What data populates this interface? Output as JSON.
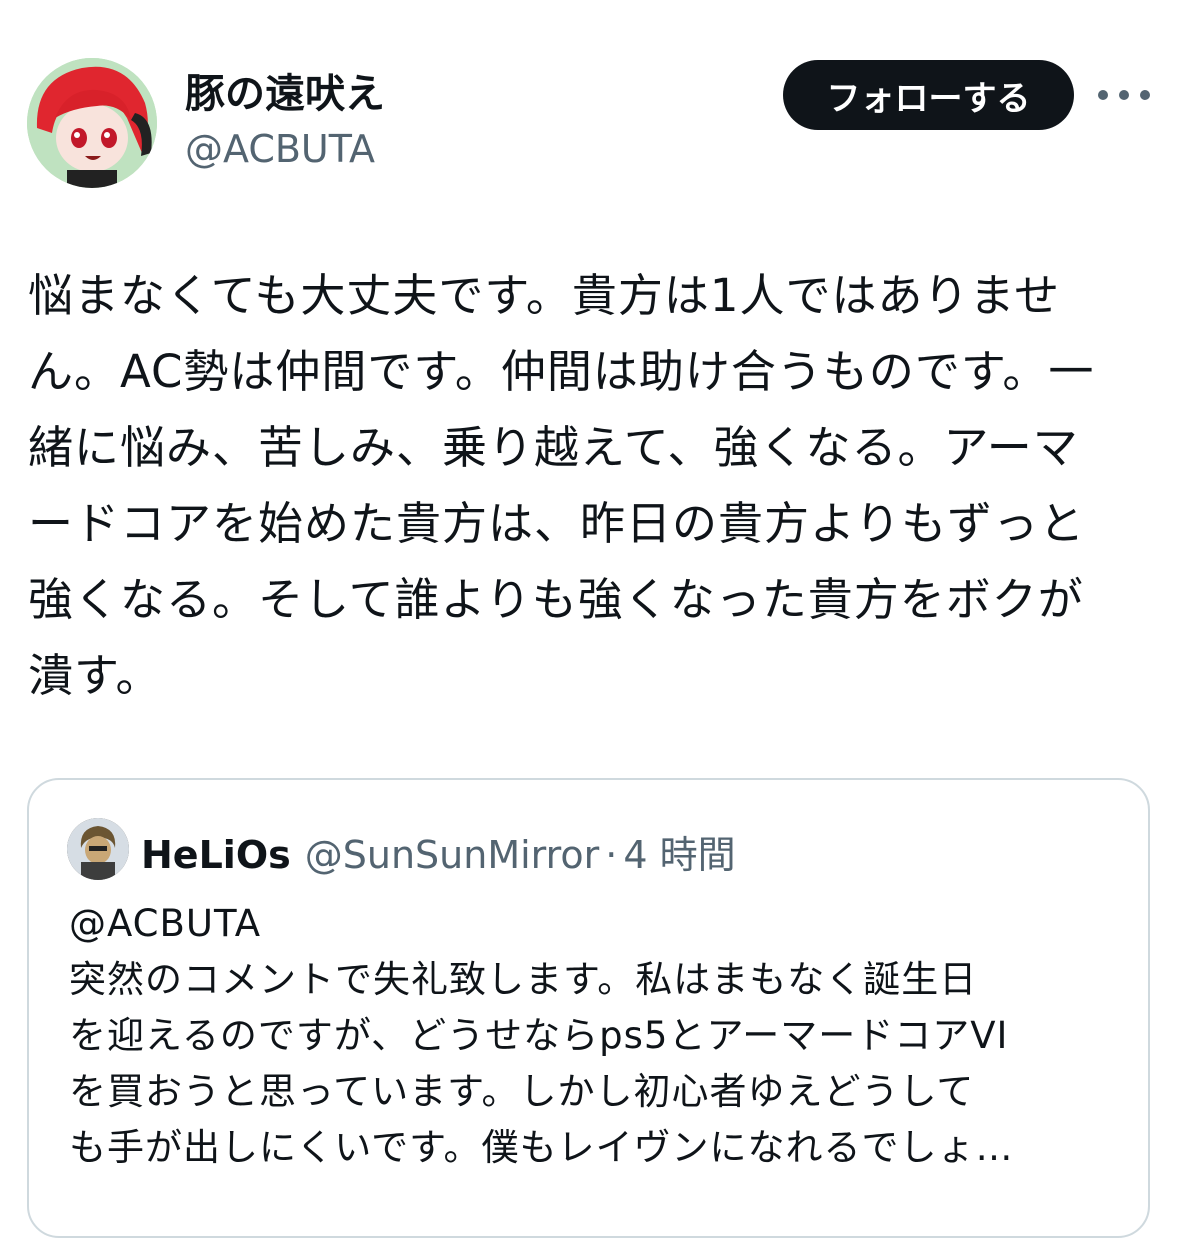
{
  "author": {
    "display_name": "豚の遠吠え",
    "handle": "@ACBUTA",
    "follow_label": "フォローする"
  },
  "tweet": {
    "text": "悩まなくても大丈夫です。貴方は1人ではありませ\nん。AC勢は仲間です。仲間は助け合うものです。一\n緒に悩み、苦しみ、乗り越えて、強くなる。アーマ\nードコアを始めた貴方は、昨日の貴方よりもずっと\n強くなる。そして誰よりも強くなった貴方をボクが\n潰す。"
  },
  "quote": {
    "name": "HeLiOs",
    "handle": "@SunSunMirror",
    "separator": "·",
    "time": "4 時間",
    "text": "@ACBUTA\n突然のコメントで失礼致します。私はまもなく誕生日\nを迎えるのですが、どうせならps5とアーマードコアVI\nを買おうと思っています。しかし初心者ゆえどうして\nも手が出しにくいです。僕もレイヴンになれるでしょ…"
  },
  "icons": {
    "more": "more-horizontal-icon"
  },
  "colors": {
    "text": "#0f1419",
    "secondary": "#536471",
    "border": "#cfd9de",
    "button": "#0f1419"
  }
}
